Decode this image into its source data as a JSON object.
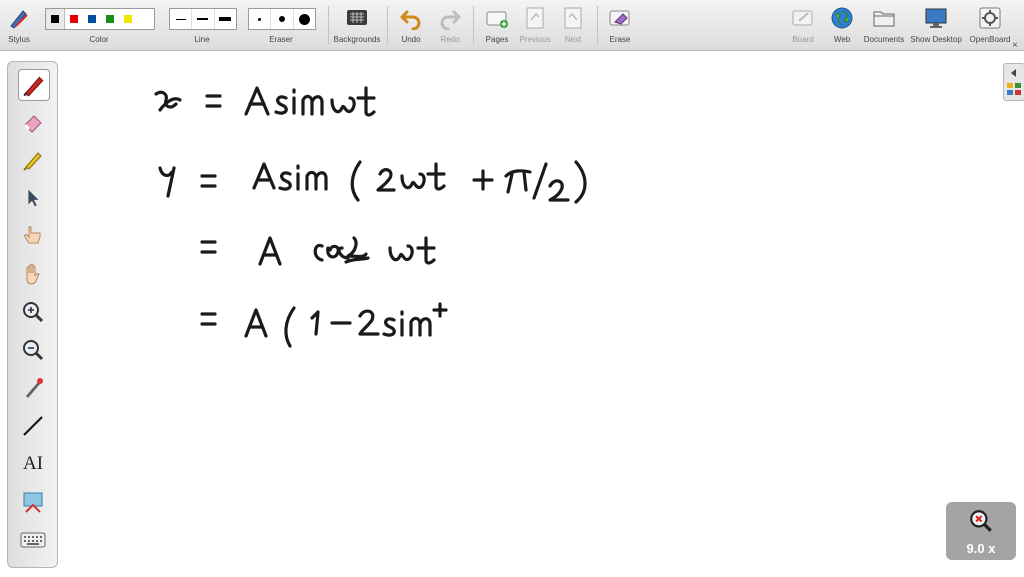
{
  "toolbar": {
    "stylus": "Stylus",
    "color": "Color",
    "line": "Line",
    "eraser": "Eraser",
    "backgrounds": "Backgrounds",
    "undo": "Undo",
    "redo": "Redo",
    "pages": "Pages",
    "previous": "Previous",
    "next": "Next",
    "erase": "Erase",
    "board": "Board",
    "web": "Web",
    "documents": "Documents",
    "show_desktop": "Show Desktop",
    "openboard": "OpenBoard"
  },
  "palette": {
    "colors": [
      "#000000",
      "#e00000",
      "#004fa3",
      "#1a8f1a",
      "#f2e600"
    ],
    "selected": "#000000"
  },
  "left_tools": [
    "pen",
    "eraser",
    "highlighter",
    "selector",
    "interactor",
    "hand",
    "zoom-in",
    "zoom-out",
    "laser-pointer",
    "line",
    "text",
    "capture",
    "virtual-keyboard"
  ],
  "zoom": {
    "label": "9.0 x"
  },
  "board_content": {
    "handwritten_lines": [
      "x = A sin ωt",
      "y = A sin (2ωt + π/2)",
      "= A cos 2ωt",
      "= A ( 1 − 2 sin+"
    ]
  },
  "accent": "#a4a4a4"
}
